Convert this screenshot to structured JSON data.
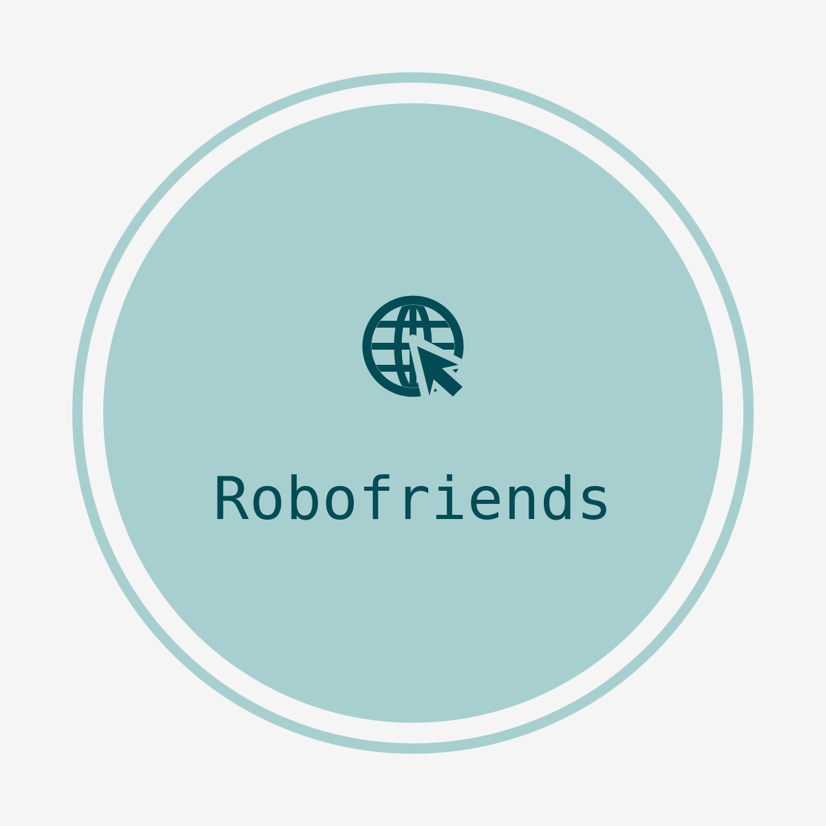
{
  "logo": {
    "brand_name": "Robofriends",
    "icon": "globe-cursor-icon"
  },
  "colors": {
    "background": "#f5f5f5",
    "ring": "#a8cfcf",
    "disc": "#a8cfcf",
    "ink": "#034b55"
  }
}
